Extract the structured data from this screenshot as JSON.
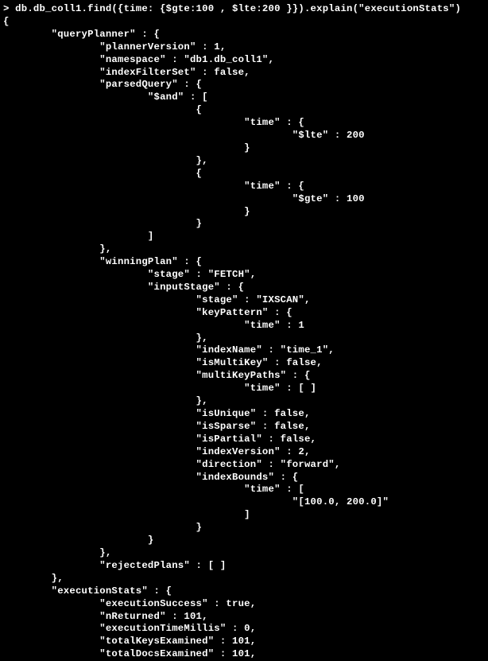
{
  "terminal": {
    "lines": [
      "> db.db_coll1.find({time: {$gte:100 , $lte:200 }}).explain(\"executionStats\")",
      "{",
      "        \"queryPlanner\" : {",
      "                \"plannerVersion\" : 1,",
      "                \"namespace\" : \"db1.db_coll1\",",
      "                \"indexFilterSet\" : false,",
      "                \"parsedQuery\" : {",
      "                        \"$and\" : [",
      "                                {",
      "                                        \"time\" : {",
      "                                                \"$lte\" : 200",
      "                                        }",
      "                                },",
      "                                {",
      "                                        \"time\" : {",
      "                                                \"$gte\" : 100",
      "                                        }",
      "                                }",
      "                        ]",
      "                },",
      "                \"winningPlan\" : {",
      "                        \"stage\" : \"FETCH\",",
      "                        \"inputStage\" : {",
      "                                \"stage\" : \"IXSCAN\",",
      "                                \"keyPattern\" : {",
      "                                        \"time\" : 1",
      "                                },",
      "                                \"indexName\" : \"time_1\",",
      "                                \"isMultiKey\" : false,",
      "                                \"multiKeyPaths\" : {",
      "                                        \"time\" : [ ]",
      "                                },",
      "                                \"isUnique\" : false,",
      "                                \"isSparse\" : false,",
      "                                \"isPartial\" : false,",
      "                                \"indexVersion\" : 2,",
      "                                \"direction\" : \"forward\",",
      "                                \"indexBounds\" : {",
      "                                        \"time\" : [",
      "                                                \"[100.0, 200.0]\"",
      "                                        ]",
      "                                }",
      "                        }",
      "                },",
      "                \"rejectedPlans\" : [ ]",
      "        },",
      "        \"executionStats\" : {",
      "                \"executionSuccess\" : true,",
      "                \"nReturned\" : 101,",
      "                \"executionTimeMillis\" : 0,",
      "                \"totalKeysExamined\" : 101,",
      "                \"totalDocsExamined\" : 101,"
    ]
  }
}
